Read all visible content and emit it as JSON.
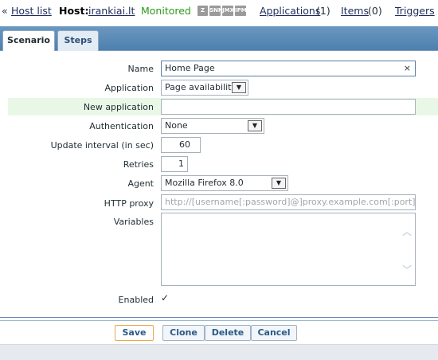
{
  "nav": {
    "back_arrow": "«",
    "host_list_label": "Host list",
    "host_label": "Host:",
    "host_name": "irankiai.lt",
    "status": "Monitored",
    "protocols": [
      "Z",
      "SNMP",
      "JMX",
      "IPMI"
    ],
    "applications_label": "Applications",
    "applications_count": "(1)",
    "items_label": "Items",
    "items_count": "(0)",
    "triggers_label": "Triggers"
  },
  "tabs": [
    {
      "label": "Scenario",
      "active": true
    },
    {
      "label": "Steps",
      "active": false
    }
  ],
  "form": {
    "name": {
      "label": "Name",
      "value": "Home Page",
      "clear_glyph": "×"
    },
    "application": {
      "label": "Application",
      "value": "Page availability"
    },
    "new_application": {
      "label": "New application",
      "value": ""
    },
    "authentication": {
      "label": "Authentication",
      "value": "None"
    },
    "update_interval": {
      "label": "Update interval (in sec)",
      "value": "60"
    },
    "retries": {
      "label": "Retries",
      "value": "1"
    },
    "agent": {
      "label": "Agent",
      "value": "Mozilla Firefox 8.0"
    },
    "http_proxy": {
      "label": "HTTP proxy",
      "placeholder": "http://[username[:password]@]proxy.example.com[:port]"
    },
    "variables": {
      "label": "Variables",
      "value": ""
    },
    "enabled": {
      "label": "Enabled",
      "checked": true,
      "check_glyph": "✓"
    }
  },
  "buttons": {
    "save": "Save",
    "clone": "Clone",
    "delete": "Delete",
    "cancel": "Cancel"
  },
  "colors": {
    "tab_strip": "#5a8ab8",
    "highlight_row": "#e9f8e6",
    "monitored": "#2a9a1a",
    "save_border": "#e8a94a"
  }
}
